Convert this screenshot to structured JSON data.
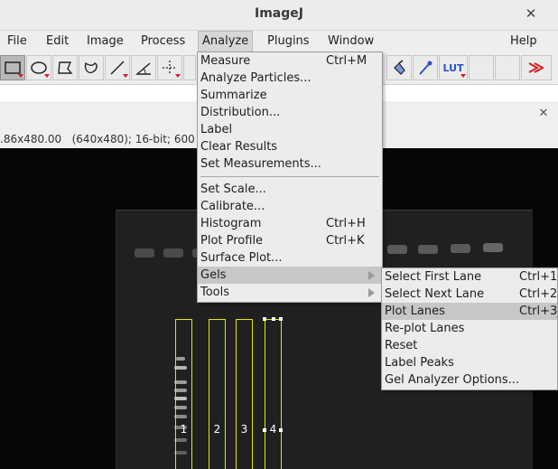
{
  "app": {
    "title": "ImageJ"
  },
  "menubar": {
    "items": [
      "File",
      "Edit",
      "Image",
      "Process",
      "Analyze",
      "Plugins",
      "Window",
      "Help"
    ],
    "active": "Analyze"
  },
  "toolbar": {
    "tools": [
      "rectangle-tool",
      "oval-tool",
      "polygon-tool",
      "freehand-tool",
      "line-tool",
      "angle-tool",
      "point-tool"
    ],
    "right_tools": [
      "dropper-tool",
      "color-picker-tool",
      "lut-tool",
      "blank-tool-1",
      "blank-tool-2",
      "more-tools"
    ],
    "lut_label": "LUT"
  },
  "image_window": {
    "info_text": ".86x480.00   (640x480); 16-bit; 600"
  },
  "analyze_menu": {
    "items": [
      {
        "label": "Measure",
        "shortcut": "Ctrl+M"
      },
      {
        "label": "Analyze Particles...",
        "shortcut": ""
      },
      {
        "label": "Summarize",
        "shortcut": ""
      },
      {
        "label": "Distribution...",
        "shortcut": ""
      },
      {
        "label": "Label",
        "shortcut": ""
      },
      {
        "label": "Clear Results",
        "shortcut": ""
      },
      {
        "label": "Set Measurements...",
        "shortcut": ""
      },
      {
        "label": "Set Scale...",
        "shortcut": ""
      },
      {
        "label": "Calibrate...",
        "shortcut": ""
      },
      {
        "label": "Histogram",
        "shortcut": "Ctrl+H"
      },
      {
        "label": "Plot Profile",
        "shortcut": "Ctrl+K"
      },
      {
        "label": "Surface Plot...",
        "shortcut": ""
      },
      {
        "label": "Gels",
        "shortcut": ""
      },
      {
        "label": "Tools",
        "shortcut": ""
      }
    ],
    "highlighted": "Gels"
  },
  "gels_submenu": {
    "items": [
      {
        "label": "Select First Lane",
        "shortcut": "Ctrl+1"
      },
      {
        "label": "Select Next Lane",
        "shortcut": "Ctrl+2"
      },
      {
        "label": "Plot Lanes",
        "shortcut": "Ctrl+3"
      },
      {
        "label": "Re-plot Lanes",
        "shortcut": ""
      },
      {
        "label": "Reset",
        "shortcut": ""
      },
      {
        "label": "Label Peaks",
        "shortcut": ""
      },
      {
        "label": "Gel Analyzer Options...",
        "shortcut": ""
      }
    ],
    "highlighted": "Plot Lanes"
  },
  "lanes": {
    "labels": [
      "1",
      "2",
      "3",
      "4"
    ]
  },
  "colors": {
    "lane_outline": "#e6e60f",
    "highlight": "#c7c7c7",
    "accent_red": "#d42020"
  }
}
